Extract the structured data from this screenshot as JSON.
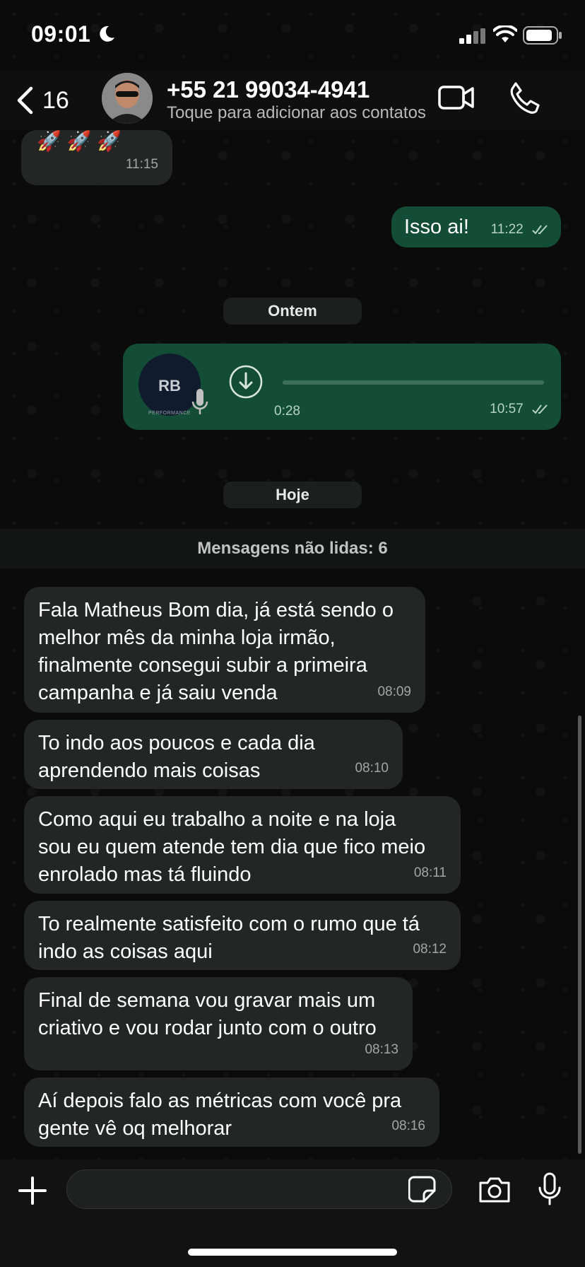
{
  "status_bar": {
    "time": "09:01"
  },
  "header": {
    "back_count": "16",
    "contact_name": "+55 21 99034-4941",
    "contact_subtitle": "Toque para adicionar aos contatos"
  },
  "messages_top": [
    {
      "direction": "in",
      "text": "",
      "time": "11:15"
    },
    {
      "direction": "out",
      "text": "Isso ai!",
      "time": "11:22",
      "read": true
    }
  ],
  "date_pills": {
    "yesterday": "Ontem",
    "today": "Hoje"
  },
  "voice_note": {
    "avatar_logo": "RB",
    "avatar_sub": "PERFORMANCE",
    "duration": "0:28",
    "time": "10:57",
    "progress": 0
  },
  "unread_banner": "Mensagens não lidas: 6",
  "messages_today": [
    {
      "lines": [
        "Fala Matheus Bom dia, já está sendo o",
        "melhor mês da minha loja irmão,",
        "finalmente consegui subir a primeira",
        "campanha e já saiu venda"
      ],
      "time": "08:09"
    },
    {
      "lines": [
        "To indo aos poucos e cada dia",
        "aprendendo mais coisas"
      ],
      "time": "08:10"
    },
    {
      "lines": [
        "Como aqui eu trabalho a noite e na loja",
        "sou eu quem atende tem dia que fico meio",
        "enrolado mas tá fluindo"
      ],
      "time": "08:11"
    },
    {
      "lines": [
        "To realmente satisfeito com o rumo que tá",
        "indo as coisas aqui"
      ],
      "time": "08:12"
    },
    {
      "lines": [
        "Final de semana vou gravar mais um",
        "criativo e vou rodar junto com o outro"
      ],
      "time": "08:13"
    },
    {
      "lines": [
        "Aí depois falo as métricas com você pra",
        "gente vê oq melhorar"
      ],
      "time": "08:16"
    }
  ],
  "composer": {
    "placeholder": ""
  },
  "colors": {
    "incoming": "#242626",
    "outgoing": "#144d37",
    "background": "#0b0b0b"
  }
}
